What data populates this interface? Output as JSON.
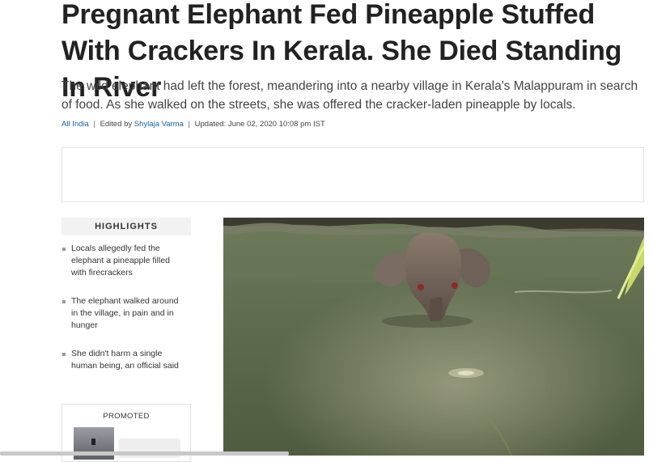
{
  "article": {
    "headline": "Pregnant Elephant Fed Pineapple Stuffed With Crackers In Kerala. She Died Standing In River",
    "summary": "The wild elephant had left the forest, meandering into a nearby village in Kerala's Malappuram in search of food. As she walked on the streets, she was offered the cracker-laden pineapple by locals.",
    "byline": {
      "category": "All India",
      "edited_by_prefix": "Edited by",
      "editor": "Shylaja Varma",
      "updated": "Updated: June 02, 2020 10:08 pm IST"
    }
  },
  "highlights": {
    "title": "HIGHLIGHTS",
    "items": [
      "Locals allegedly fed the elephant a pineapple filled with firecrackers",
      "The elephant walked around in the village, in pain and in hunger",
      "She didn't harm a single human being, an official said"
    ]
  },
  "promoted": {
    "label": "PROMOTED"
  },
  "colors": {
    "link": "#1a5f9e",
    "headline": "#222222",
    "water": "#5d6a4c"
  }
}
